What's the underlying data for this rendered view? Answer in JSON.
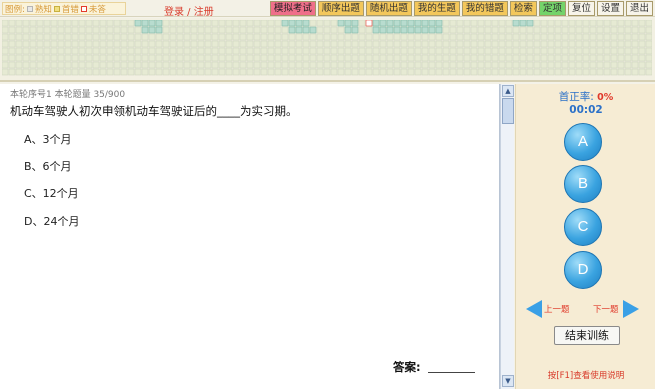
{
  "legend": {
    "prefix": "图例:",
    "known": "熟知",
    "wrong": "首错",
    "unanswered": "未答"
  },
  "login": {
    "login": "登录",
    "sep": " / ",
    "register": "注册"
  },
  "tabs": [
    {
      "label": "模拟考试",
      "style": "pink"
    },
    {
      "label": "顺序出题",
      "style": "yellow"
    },
    {
      "label": "随机出题",
      "style": "yellow"
    },
    {
      "label": "我的生题",
      "style": "yellow"
    },
    {
      "label": "我的错题",
      "style": "yellow"
    },
    {
      "label": "检索",
      "style": "yellow"
    },
    {
      "label": "定项",
      "style": "green"
    },
    {
      "label": "复位",
      "style": "light"
    },
    {
      "label": "设置",
      "style": "light"
    },
    {
      "label": "退出",
      "style": "light"
    }
  ],
  "question": {
    "meta": "本轮序号1 本轮题量 35/900",
    "text": "机动车驾驶人初次申领机动车驾驶证后的____为实习期。",
    "options": [
      "A、3个月",
      "B、6个月",
      "C、12个月",
      "D、24个月"
    ],
    "answer_label": "答案:"
  },
  "side": {
    "rate_label": "首正率:",
    "rate_value": "0%",
    "timer": "00:02",
    "buttons": [
      "A",
      "B",
      "C",
      "D"
    ],
    "prev": "上一题",
    "next": "下一题",
    "end": "结束训练",
    "help": "按[F1]查看使用说明"
  },
  "colors": {
    "grid_empty": "#e6ead3",
    "grid_known": "#b8dccf",
    "grid_current": "#e43b2c",
    "accent": "#3aa3e0"
  },
  "scrollbar": {
    "up_icon": "▲",
    "down_icon": "▼"
  }
}
